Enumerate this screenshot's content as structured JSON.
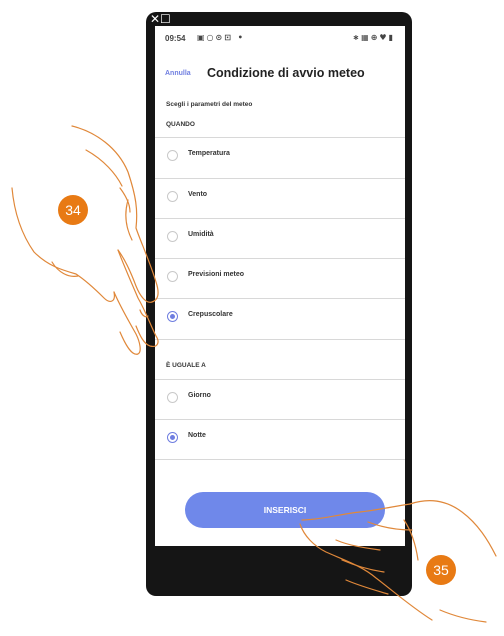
{
  "window_icons": "✕☐",
  "statusbar": {
    "time": "09:54",
    "left_icons": "▣○⊙⊡ •",
    "right_icons": "∗▦⊕♥▮"
  },
  "header": {
    "cancel_label": "Annulla",
    "title": "Condizione di avvio meteo"
  },
  "section": {
    "intro": "Scegli i parametri del meteo",
    "when_label": "QUANDO",
    "equals_label": "È UGUALE A"
  },
  "when_options": [
    {
      "label": "Temperatura",
      "checked": false
    },
    {
      "label": "Vento",
      "checked": false
    },
    {
      "label": "Umidità",
      "checked": false
    },
    {
      "label": "Previsioni meteo",
      "checked": false
    },
    {
      "label": "Crepuscolare",
      "checked": true
    }
  ],
  "equals_options": [
    {
      "label": "Giorno",
      "checked": false
    },
    {
      "label": "Notte",
      "checked": true
    }
  ],
  "insert_label": "INSERISCI",
  "annotations": {
    "step_a": "34",
    "step_b": "35"
  },
  "colors": {
    "accent": "#6f7ee0",
    "button": "#6f88ea",
    "badge": "#e87a14"
  }
}
